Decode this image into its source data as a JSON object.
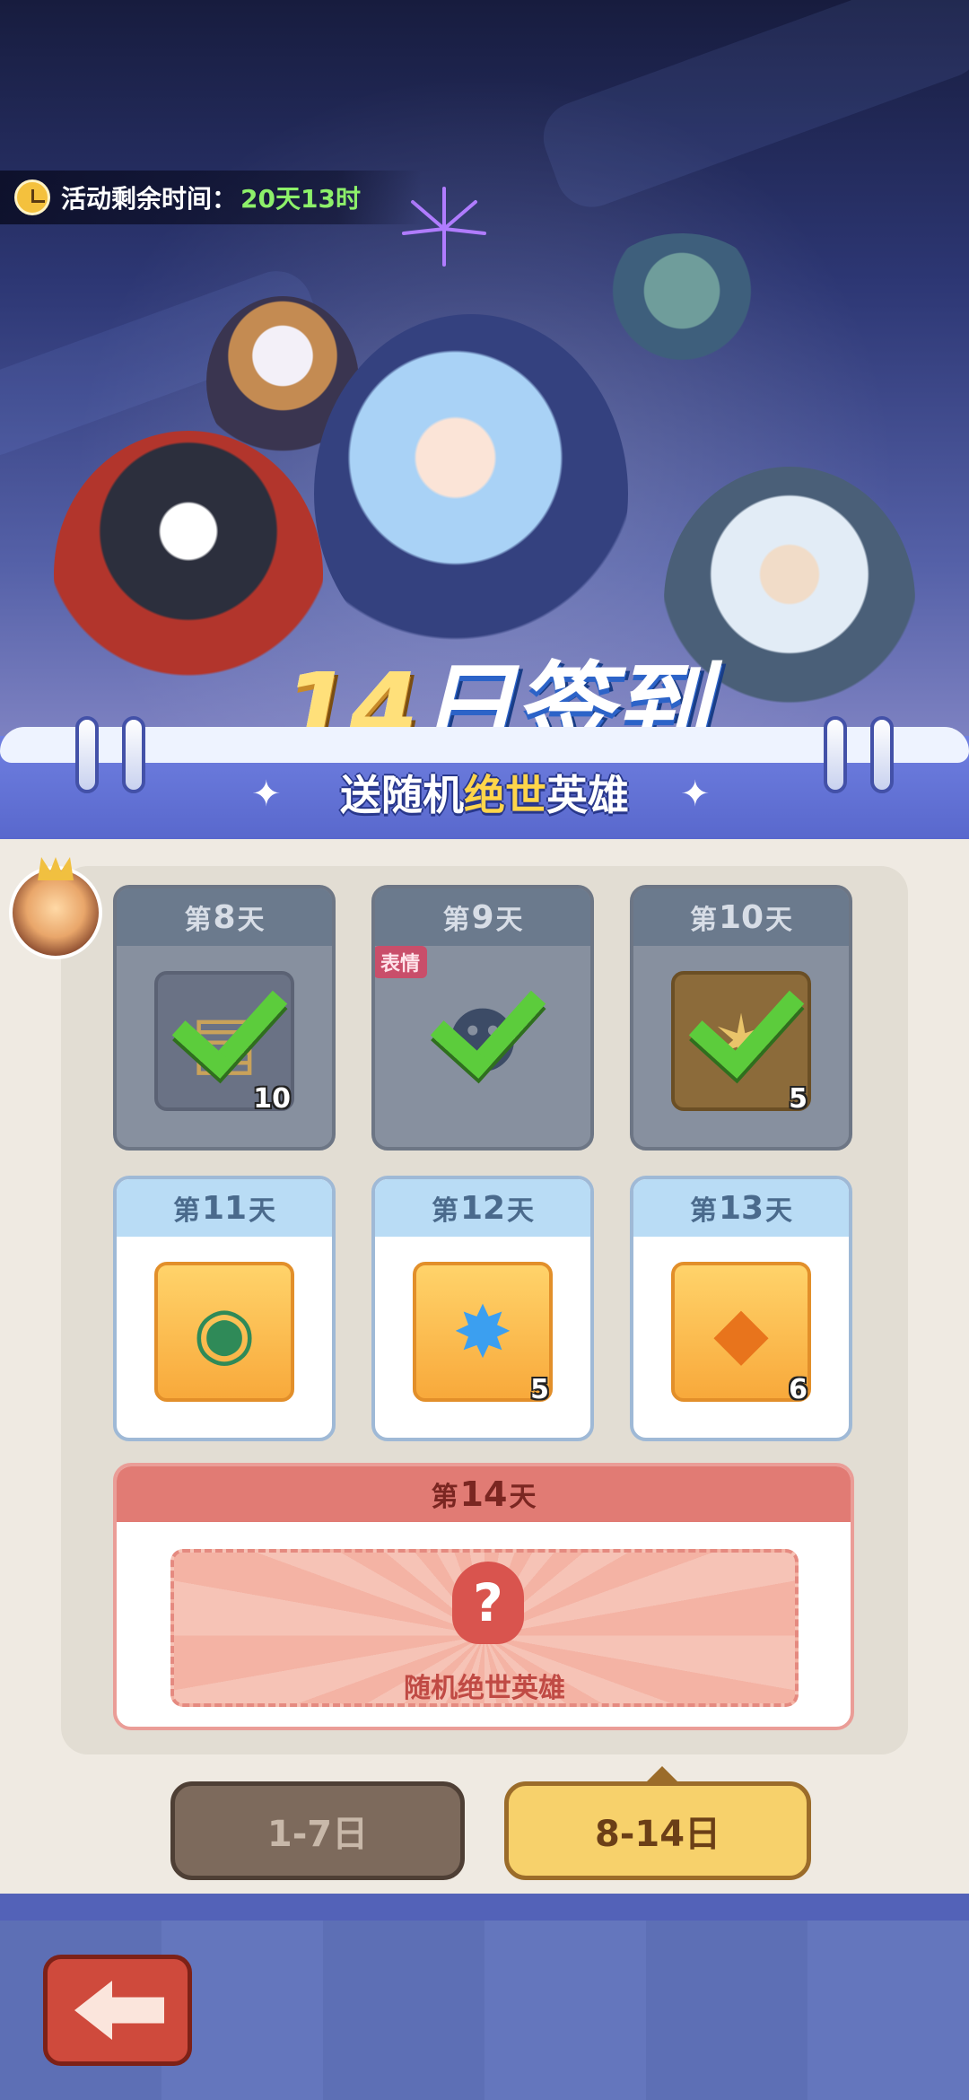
{
  "timer": {
    "label": "活动剩余时间：",
    "value": "20天13时"
  },
  "banner": {
    "title_num": "14",
    "title_text": "日签到",
    "subtitle_part1": "送随机",
    "subtitle_highlight": "绝世",
    "subtitle_part2": "英雄"
  },
  "days": [
    {
      "prefix": "第",
      "num": "8",
      "suffix": "天",
      "status": "claimed",
      "quantity": "10",
      "icon": "scroll-item-icon"
    },
    {
      "prefix": "第",
      "num": "9",
      "suffix": "天",
      "status": "claimed",
      "quantity": "",
      "icon": "emote-item-icon",
      "tag": "表情"
    },
    {
      "prefix": "第",
      "num": "10",
      "suffix": "天",
      "status": "claimed",
      "quantity": "5",
      "icon": "star-badge-icon"
    },
    {
      "prefix": "第",
      "num": "11",
      "suffix": "天",
      "status": "unclaimed",
      "quantity": "",
      "icon": "compass-icon"
    },
    {
      "prefix": "第",
      "num": "12",
      "suffix": "天",
      "status": "unclaimed",
      "quantity": "5",
      "icon": "blue-star-icon"
    },
    {
      "prefix": "第",
      "num": "13",
      "suffix": "天",
      "status": "unclaimed",
      "quantity": "6",
      "icon": "amber-gem-icon"
    }
  ],
  "final_day": {
    "prefix": "第",
    "num": "14",
    "suffix": "天",
    "reward_label": "随机绝世英雄",
    "mystery_symbol": "?"
  },
  "tabs": {
    "first": "1-7日",
    "second": "8-14日",
    "active": "8-14日"
  },
  "colors": {
    "claimed": "#87909f",
    "unclaimed_header": "#b9dcf5",
    "final_header": "#e17b74",
    "timer_value": "#8df06a"
  }
}
